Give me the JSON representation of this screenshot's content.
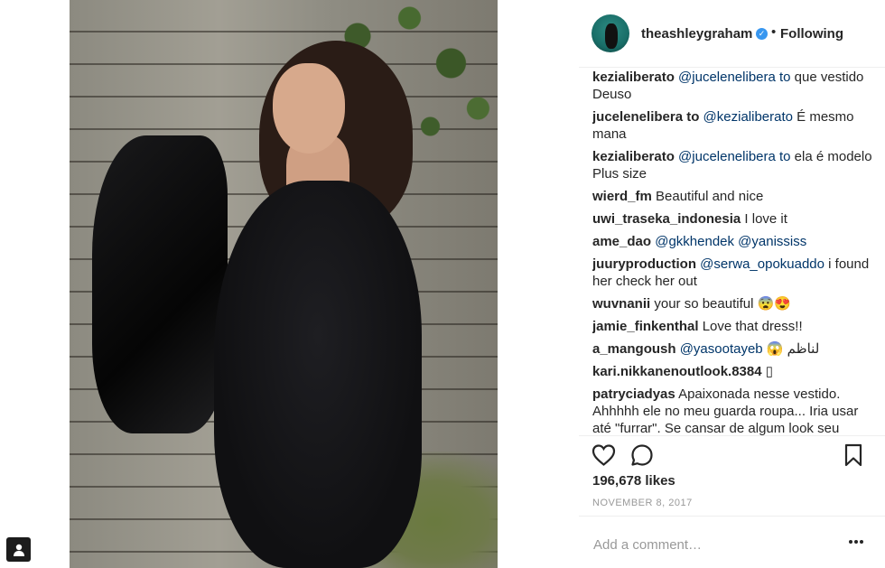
{
  "post": {
    "username": "theashleygraham",
    "verified_icon": "verified-badge-icon",
    "separator": "•",
    "follow_status": "Following",
    "likes": "196,678 likes",
    "date": "NOVEMBER 8, 2017",
    "add_comment_placeholder": "Add a comment…"
  },
  "comments": [
    {
      "author": "kezialiberato",
      "mention": "@jucelenelibera to",
      "text": " que vestido Deuso"
    },
    {
      "author": "jucelenelibera to",
      "mention": "@kezialiberato",
      "text": " É mesmo mana"
    },
    {
      "author": "kezialiberato",
      "mention": "@jucelenelibera to",
      "text": " ela é modelo Plus size"
    },
    {
      "author": "wierd_fm",
      "mention": "",
      "text": " Beautiful and nice"
    },
    {
      "author": "uwi_traseka_indonesia",
      "mention": "",
      "text": " I love it"
    },
    {
      "author": "ame_dao",
      "mention": "@gkkhendek @yanississ",
      "text": ""
    },
    {
      "author": "juuryproduction",
      "mention": "@serwa_opokuaddo",
      "text": " i found her check her out"
    },
    {
      "author": "wuvnanii",
      "mention": "",
      "text": " your so beautiful 😨😍"
    },
    {
      "author": "jamie_finkenthal",
      "mention": "",
      "text": " Love that dress!!"
    },
    {
      "author": "a_mangoush",
      "mention": "@yasootayeb",
      "text": " 😱 لناظم"
    },
    {
      "author": "kari.nikkanenoutlook.8384",
      "mention": "",
      "text": " ▯"
    },
    {
      "author": "patryciadyas",
      "mention": "",
      "text": " Apaixonada nesse vestido. Ahhhhh ele no meu guarda roupa... Iria usar até \"furrar\". Se cansar de algum look seu"
    }
  ],
  "colors": {
    "mention": "#003569",
    "text": "#262626",
    "muted": "#999999",
    "verified": "#3897f0"
  }
}
